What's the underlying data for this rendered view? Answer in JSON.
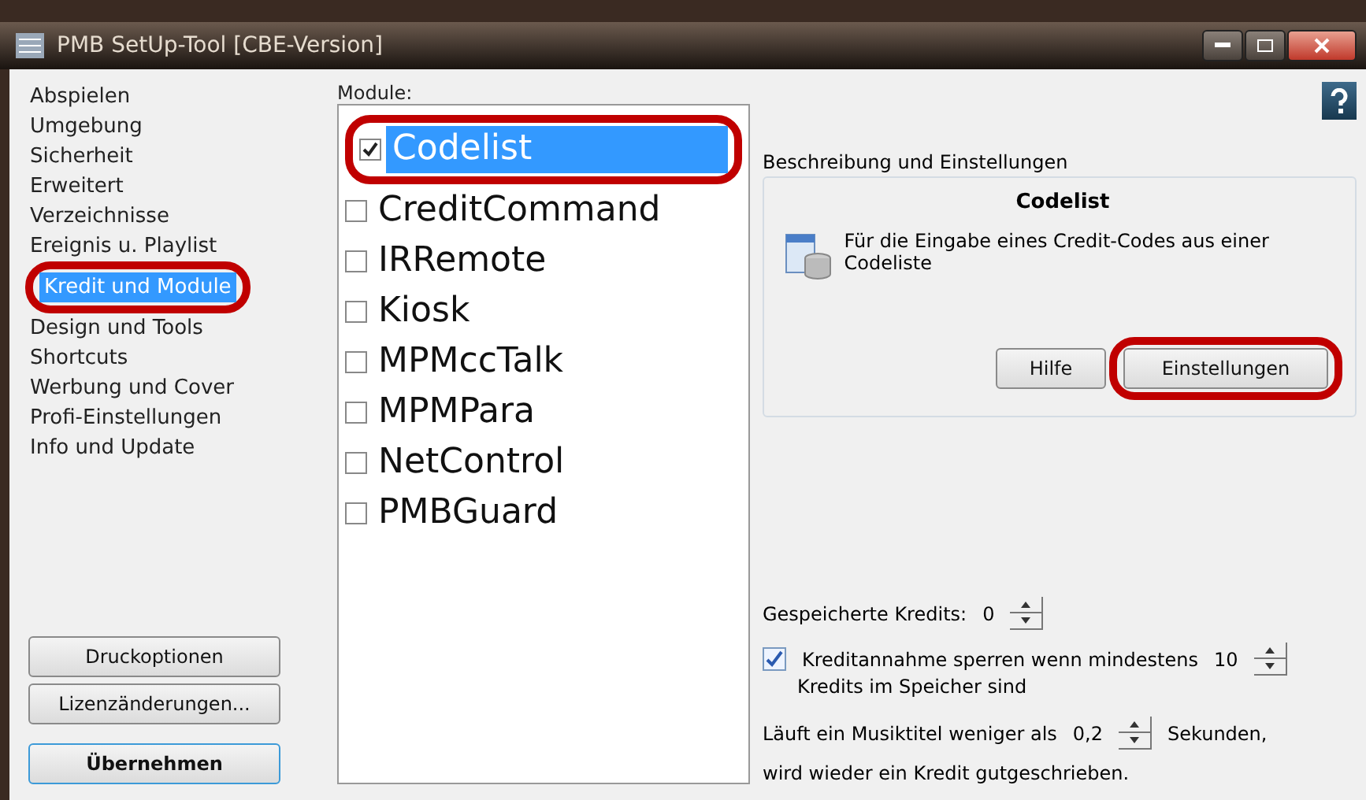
{
  "window": {
    "title": "PMB SetUp-Tool [CBE-Version]"
  },
  "sidebar": {
    "items": [
      {
        "label": "Abspielen",
        "selected": false,
        "annotated": false
      },
      {
        "label": "Umgebung",
        "selected": false,
        "annotated": false
      },
      {
        "label": "Sicherheit",
        "selected": false,
        "annotated": false
      },
      {
        "label": "Erweitert",
        "selected": false,
        "annotated": false
      },
      {
        "label": "Verzeichnisse",
        "selected": false,
        "annotated": false
      },
      {
        "label": "Ereignis u. Playlist",
        "selected": false,
        "annotated": false
      },
      {
        "label": "Kredit und Module",
        "selected": true,
        "annotated": true
      },
      {
        "label": "Design und Tools",
        "selected": false,
        "annotated": false
      },
      {
        "label": "Shortcuts",
        "selected": false,
        "annotated": false
      },
      {
        "label": "Werbung und Cover",
        "selected": false,
        "annotated": false
      },
      {
        "label": "Profi-Einstellungen",
        "selected": false,
        "annotated": false
      },
      {
        "label": "Info und Update",
        "selected": false,
        "annotated": false
      }
    ],
    "buttons": [
      {
        "label": "Druckoptionen",
        "default": false
      },
      {
        "label": "Lizenzänderungen...",
        "default": false
      },
      {
        "label": "Übernehmen",
        "default": true
      }
    ]
  },
  "modules": {
    "label": "Module:",
    "items": [
      {
        "label": "Codelist",
        "checked": true,
        "selected": true,
        "annotated": true
      },
      {
        "label": "CreditCommand",
        "checked": false,
        "selected": false,
        "annotated": false
      },
      {
        "label": "IRRemote",
        "checked": false,
        "selected": false,
        "annotated": false
      },
      {
        "label": "Kiosk",
        "checked": false,
        "selected": false,
        "annotated": false
      },
      {
        "label": "MPMccTalk",
        "checked": false,
        "selected": false,
        "annotated": false
      },
      {
        "label": "MPMPara",
        "checked": false,
        "selected": false,
        "annotated": false
      },
      {
        "label": "NetControl",
        "checked": false,
        "selected": false,
        "annotated": false
      },
      {
        "label": "PMBGuard",
        "checked": false,
        "selected": false,
        "annotated": false
      }
    ]
  },
  "details": {
    "group_title": "Beschreibung und Einstellungen",
    "title": "Codelist",
    "description": "Für die Eingabe eines Credit-Codes aus einer Codeliste",
    "buttons": [
      {
        "label": "Hilfe",
        "annotated": false
      },
      {
        "label": "Einstellungen",
        "annotated": true
      }
    ]
  },
  "settings": {
    "stored_credits": {
      "label": "Gespeicherte Kredits:",
      "value": "0"
    },
    "lock": {
      "checked": true,
      "label": "Kreditannahme sperren wenn mindestens",
      "value": "10",
      "line2": "Kredits im Speicher sind"
    },
    "skip": {
      "label": "Läuft ein Musiktitel weniger als",
      "value": "0,2",
      "suffix": "Sekunden,",
      "line2": "wird wieder ein Kredit gutgeschrieben."
    }
  }
}
